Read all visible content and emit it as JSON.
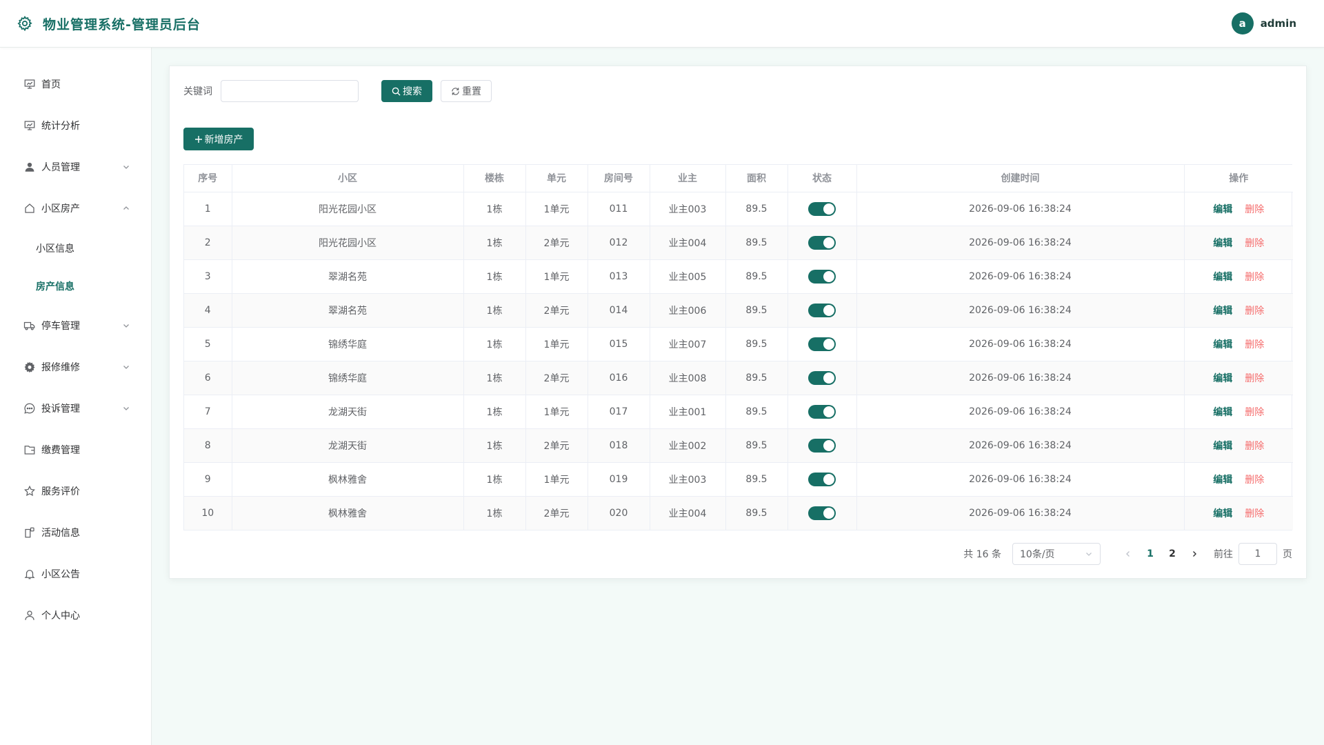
{
  "header": {
    "title": "物业管理系统-管理员后台",
    "avatar_letter": "a",
    "username": "admin"
  },
  "sidebar": {
    "items": [
      {
        "key": "home",
        "label": "首页",
        "icon": "presentation-chart-icon",
        "expandable": false
      },
      {
        "key": "stats",
        "label": "统计分析",
        "icon": "presentation-chart-icon",
        "expandable": false
      },
      {
        "key": "people",
        "label": "人员管理",
        "icon": "user-icon",
        "expandable": true,
        "expanded": false
      },
      {
        "key": "estate",
        "label": "小区房产",
        "icon": "house-icon",
        "expandable": true,
        "expanded": true,
        "children": [
          {
            "key": "community-info",
            "label": "小区信息",
            "active": false
          },
          {
            "key": "property-info",
            "label": "房产信息",
            "active": true
          }
        ]
      },
      {
        "key": "parking",
        "label": "停车管理",
        "icon": "truck-icon",
        "expandable": true,
        "expanded": false
      },
      {
        "key": "repair",
        "label": "报修维修",
        "icon": "gear-icon",
        "expandable": true,
        "expanded": false
      },
      {
        "key": "complaint",
        "label": "投诉管理",
        "icon": "chat-icon",
        "expandable": true,
        "expanded": false
      },
      {
        "key": "payment",
        "label": "缴费管理",
        "icon": "wallet-icon",
        "expandable": false
      },
      {
        "key": "review",
        "label": "服务评价",
        "icon": "star-icon",
        "expandable": false
      },
      {
        "key": "activity",
        "label": "活动信息",
        "icon": "document-tag-icon",
        "expandable": false
      },
      {
        "key": "notice",
        "label": "小区公告",
        "icon": "bell-icon",
        "expandable": false
      },
      {
        "key": "profile",
        "label": "个人中心",
        "icon": "user-outline-icon",
        "expandable": false
      }
    ]
  },
  "search": {
    "label": "关键词",
    "value": "",
    "placeholder": "",
    "search_button": "搜索",
    "reset_button": "重置"
  },
  "toolbar": {
    "add_button": "新增房产"
  },
  "table": {
    "columns": [
      "序号",
      "小区",
      "楼栋",
      "单元",
      "房间号",
      "业主",
      "面积",
      "状态",
      "创建时间",
      "操作"
    ],
    "rows": [
      {
        "index": "1",
        "community": "阳光花园小区",
        "building": "1栋",
        "unit": "1单元",
        "room": "011",
        "owner": "业主003",
        "area": "89.5",
        "status": true,
        "created": "2026-09-06 16:38:24"
      },
      {
        "index": "2",
        "community": "阳光花园小区",
        "building": "1栋",
        "unit": "2单元",
        "room": "012",
        "owner": "业主004",
        "area": "89.5",
        "status": true,
        "created": "2026-09-06 16:38:24"
      },
      {
        "index": "3",
        "community": "翠湖名苑",
        "building": "1栋",
        "unit": "1单元",
        "room": "013",
        "owner": "业主005",
        "area": "89.5",
        "status": true,
        "created": "2026-09-06 16:38:24"
      },
      {
        "index": "4",
        "community": "翠湖名苑",
        "building": "1栋",
        "unit": "2单元",
        "room": "014",
        "owner": "业主006",
        "area": "89.5",
        "status": true,
        "created": "2026-09-06 16:38:24"
      },
      {
        "index": "5",
        "community": "锦绣华庭",
        "building": "1栋",
        "unit": "1单元",
        "room": "015",
        "owner": "业主007",
        "area": "89.5",
        "status": true,
        "created": "2026-09-06 16:38:24"
      },
      {
        "index": "6",
        "community": "锦绣华庭",
        "building": "1栋",
        "unit": "2单元",
        "room": "016",
        "owner": "业主008",
        "area": "89.5",
        "status": true,
        "created": "2026-09-06 16:38:24"
      },
      {
        "index": "7",
        "community": "龙湖天街",
        "building": "1栋",
        "unit": "1单元",
        "room": "017",
        "owner": "业主001",
        "area": "89.5",
        "status": true,
        "created": "2026-09-06 16:38:24"
      },
      {
        "index": "8",
        "community": "龙湖天街",
        "building": "1栋",
        "unit": "2单元",
        "room": "018",
        "owner": "业主002",
        "area": "89.5",
        "status": true,
        "created": "2026-09-06 16:38:24"
      },
      {
        "index": "9",
        "community": "枫林雅舍",
        "building": "1栋",
        "unit": "1单元",
        "room": "019",
        "owner": "业主003",
        "area": "89.5",
        "status": true,
        "created": "2026-09-06 16:38:24"
      },
      {
        "index": "10",
        "community": "枫林雅舍",
        "building": "1栋",
        "unit": "2单元",
        "room": "020",
        "owner": "业主004",
        "area": "89.5",
        "status": true,
        "created": "2026-09-06 16:38:24"
      }
    ],
    "actions": {
      "edit": "编辑",
      "delete": "删除"
    }
  },
  "pagination": {
    "total_text": "共 16 条",
    "page_size": "10条/页",
    "pages": [
      "1",
      "2"
    ],
    "current": "1",
    "goto_prefix": "前往",
    "goto_value": "1",
    "goto_suffix": "页"
  },
  "colors": {
    "primary": "#176f65",
    "danger": "#f56c6c",
    "background": "#f3faf8"
  }
}
